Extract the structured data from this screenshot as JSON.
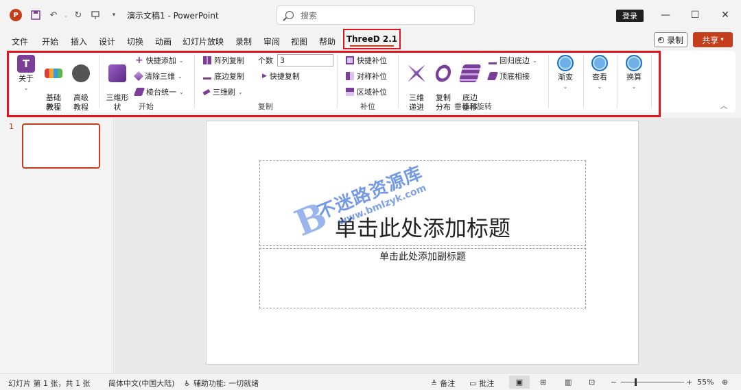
{
  "app": {
    "doc_title": "演示文稿1  -  PowerPoint",
    "logo_letter": "P",
    "search_placeholder": "搜索",
    "login_label": "登录"
  },
  "menu": {
    "tabs": [
      "文件",
      "开始",
      "插入",
      "设计",
      "切换",
      "动画",
      "幻灯片放映",
      "录制",
      "审阅",
      "视图",
      "帮助"
    ],
    "active_tab": "ThreeD 2.1",
    "record_label": "录制",
    "share_label": "共享"
  },
  "ribbon": {
    "about": {
      "about": "关于",
      "basic": "基础\n教程",
      "advanced": "高级\n教程",
      "group": "关于"
    },
    "start": {
      "shape": "三维形\n状",
      "quick_add": "快捷添加",
      "clear": "清除三维",
      "bevel": "棱台统一",
      "group": "开始"
    },
    "copy": {
      "array": "阵列复制",
      "edge": "底边复制",
      "brush": "三维刷",
      "count_label": "个数",
      "count_value": "3",
      "quick_copy": "快捷复制",
      "group": "复制"
    },
    "fill": {
      "quick": "快捷补位",
      "sym": "对称补位",
      "region": "区域补位",
      "group": "补位"
    },
    "stack": {
      "progressive": "三维\n递进",
      "distribute": "复制\n分布",
      "edge_stack": "底边\n垂移",
      "return_edge": "回归底边",
      "top_connect": "顶底相接",
      "group": "垂移和旋转"
    },
    "gradient": "渐变",
    "view": "查看",
    "convert": "换算"
  },
  "thumbnail": {
    "number": "1"
  },
  "slide": {
    "title_placeholder": "单击此处添加标题",
    "subtitle_placeholder": "单击此处添加副标题"
  },
  "watermark": {
    "main": "不迷路资源库",
    "url": "www.bmlzyk.com",
    "letter": "B"
  },
  "status": {
    "slide_info": "幻灯片 第 1 张，共 1 张",
    "language": "简体中文(中国大陆)",
    "accessibility": "辅助功能: 一切就绪",
    "notes": "备注",
    "comments": "批注",
    "zoom": "55%"
  },
  "colors": {
    "accent": "#c43e1c",
    "highlight": "#e0141e"
  }
}
